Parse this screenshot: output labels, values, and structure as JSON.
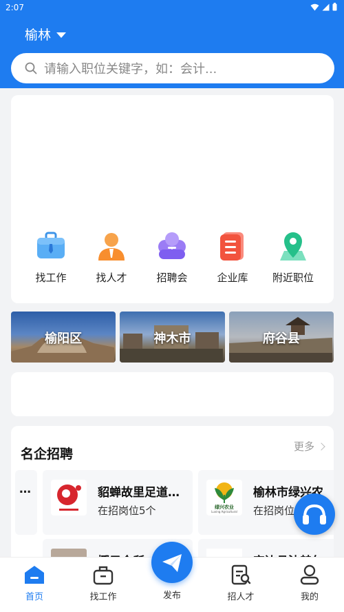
{
  "status_bar": {
    "time": "2:07"
  },
  "header": {
    "city": "榆林",
    "search_placeholder": "请输入职位关键字，如：会计..."
  },
  "quick_nav": [
    {
      "label": "找工作",
      "icon": "briefcase-icon"
    },
    {
      "label": "找人才",
      "icon": "person-icon"
    },
    {
      "label": "招聘会",
      "icon": "group-icon"
    },
    {
      "label": "企业库",
      "icon": "document-icon"
    },
    {
      "label": "附近职位",
      "icon": "map-pin-icon"
    }
  ],
  "districts": [
    {
      "label": "榆阳区"
    },
    {
      "label": "神木市"
    },
    {
      "label": "府谷县"
    }
  ],
  "companies_section": {
    "title": "名企招聘",
    "more_label": "更多",
    "left_partial": "…",
    "cards": [
      {
        "name": "貂蝉故里足道…",
        "info": "在招岗位5个"
      },
      {
        "name": "榆林市绿兴农",
        "info": "在招岗位"
      },
      {
        "name": "椰子会所"
      },
      {
        "name": "定边县沐赫尔"
      }
    ],
    "logo_text": {
      "card2": "绿兴农业",
      "card2_sub": "Luxing Agricultural"
    }
  },
  "tabbar": [
    {
      "label": "首页",
      "icon": "home-icon",
      "active": true
    },
    {
      "label": "找工作",
      "icon": "briefcase-icon"
    },
    {
      "label": "发布",
      "icon": "paper-plane-icon"
    },
    {
      "label": "招人才",
      "icon": "resume-search-icon"
    },
    {
      "label": "我的",
      "icon": "user-icon"
    }
  ],
  "colors": {
    "brand": "#1e7cf0",
    "background": "#f2f3f5"
  }
}
